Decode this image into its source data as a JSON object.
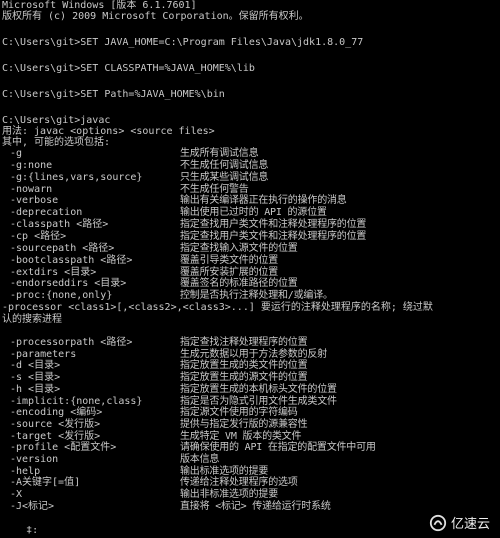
{
  "console": {
    "header": [
      "Microsoft Windows [版本 6.1.7601]",
      "版权所有 (c) 2009 Microsoft Corporation。保留所有权利。",
      "",
      "C:\\Users\\git>SET JAVA_HOME=C:\\Program Files\\Java\\jdk1.8.0_77",
      "",
      "C:\\Users\\git>SET CLASSPATH=%JAVA_HOME%\\lib",
      "",
      "C:\\Users\\git>SET Path=%JAVA_HOME%\\bin",
      "",
      "C:\\Users\\git>javac",
      "用法: javac <options> <source files>",
      "其中, 可能的选项包括:"
    ],
    "options": [
      {
        "opt": "-g",
        "desc": "生成所有调试信息"
      },
      {
        "opt": "-g:none",
        "desc": "不生成任何调试信息"
      },
      {
        "opt": "-g:{lines,vars,source}",
        "desc": "只生成某些调试信息"
      },
      {
        "opt": "-nowarn",
        "desc": "不生成任何警告"
      },
      {
        "opt": "-verbose",
        "desc": "输出有关编译器正在执行的操作的消息"
      },
      {
        "opt": "-deprecation",
        "desc": "输出使用已过时的 API 的源位置"
      },
      {
        "opt": "-classpath <路径>",
        "desc": "指定查找用户类文件和注释处理程序的位置"
      },
      {
        "opt": "-cp <路径>",
        "desc": "指定查找用户类文件和注释处理程序的位置"
      },
      {
        "opt": "-sourcepath <路径>",
        "desc": "指定查找输入源文件的位置"
      },
      {
        "opt": "-bootclasspath <路径>",
        "desc": "覆盖引导类文件的位置"
      },
      {
        "opt": "-extdirs <目录>",
        "desc": "覆盖所安装扩展的位置"
      },
      {
        "opt": "-endorseddirs <目录>",
        "desc": "覆盖签名的标准路径的位置"
      },
      {
        "opt": "-proc:{none,only}",
        "desc": "控制是否执行注释处理和/或编译。"
      }
    ],
    "processor_line": "-processor <class1>[,<class2>,<class3>...] 要运行的注释处理程序的名称; 绕过默",
    "processor_line2": "认的搜索进程",
    "options2": [
      {
        "opt": "-processorpath <路径>",
        "desc": "指定查找注释处理程序的位置"
      },
      {
        "opt": "-parameters",
        "desc": "生成元数据以用于方法参数的反射"
      },
      {
        "opt": "-d <目录>",
        "desc": "指定放置生成的类文件的位置"
      },
      {
        "opt": "-s <目录>",
        "desc": "指定放置生成的源文件的位置"
      },
      {
        "opt": "-h <目录>",
        "desc": "指定放置生成的本机标头文件的位置"
      },
      {
        "opt": "-implicit:{none,class}",
        "desc": "指定是否为隐式引用文件生成类文件"
      },
      {
        "opt": "-encoding <编码>",
        "desc": "指定源文件使用的字符编码"
      },
      {
        "opt": "-source <发行版>",
        "desc": "提供与指定发行版的源兼容性"
      },
      {
        "opt": "-target <发行版>",
        "desc": "生成特定 VM 版本的类文件"
      },
      {
        "opt": "-profile <配置文件>",
        "desc": "请确保使用的 API 在指定的配置文件中可用"
      },
      {
        "opt": "-version",
        "desc": "版本信息"
      },
      {
        "opt": "-help",
        "desc": "输出标准选项的提要"
      },
      {
        "opt": "-A关键字[=值]",
        "desc": "传递给注释处理程序的选项"
      },
      {
        "opt": "-X",
        "desc": "输出非标准选项的提要"
      },
      {
        "opt": "-J<标记>",
        "desc": "直接将 <标记> 传递给运行时系统"
      }
    ],
    "footer": "    ‡:"
  },
  "watermark": {
    "text": "亿速云",
    "icon": "yisu-cloud-logo-icon"
  }
}
